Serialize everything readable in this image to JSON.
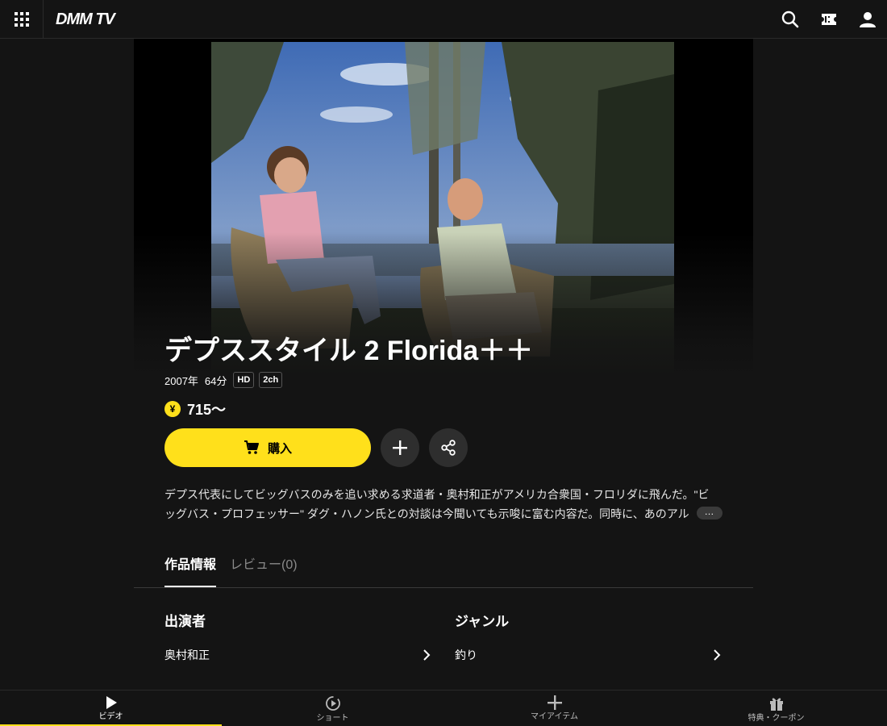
{
  "header": {
    "logo": "DMM TV"
  },
  "content": {
    "title": "デプススタイル 2 Florida＋＋",
    "year": "2007年",
    "duration": "64分",
    "badges": [
      "HD",
      "2ch"
    ],
    "price": "715～",
    "currency_symbol": "¥",
    "buy_label": "購入",
    "description_lines": [
      "デプス代表にしてビッグバスのみを追い求める求道者・奥村和正がアメリカ合衆国・フロリダに飛んだ。\"ビ",
      "ッグバス・プロフェッサー\" ダグ・ハノン氏との対談は今聞いても示唆に富む内容だ。同時に、あのアル"
    ],
    "more_label": "…"
  },
  "tabs": [
    {
      "label": "作品情報",
      "active": true
    },
    {
      "label": "レビュー(0)",
      "active": false
    }
  ],
  "info": {
    "cast_title": "出演者",
    "cast_value": "奥村和正",
    "genre_title": "ジャンル",
    "genre_value": "釣り"
  },
  "bottom_nav": [
    {
      "label": "ビデオ",
      "icon": "play-icon",
      "active": true
    },
    {
      "label": "ショート",
      "icon": "short-icon",
      "active": false
    },
    {
      "label": "マイアイテム",
      "icon": "plus-icon",
      "active": false
    },
    {
      "label": "特典・クーポン",
      "icon": "gift-icon",
      "active": false
    }
  ],
  "colors": {
    "accent": "#ffe01b",
    "background": "#141414"
  }
}
